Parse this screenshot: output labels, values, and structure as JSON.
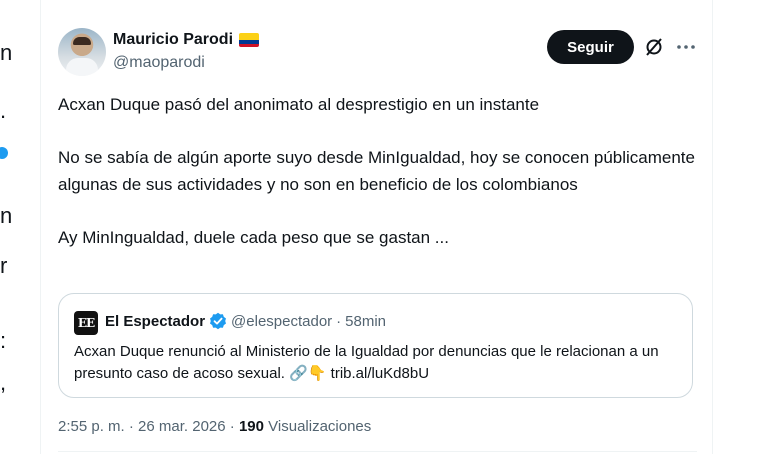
{
  "author": {
    "display_name": "Mauricio Parodi",
    "handle": "@maoparodi",
    "flag": "colombia-flag-icon"
  },
  "actions": {
    "follow_label": "Seguir"
  },
  "tweet": {
    "text": "Acxan Duque pasó del anonimato al desprestigio en un instante\n\nNo se sabía de algún aporte suyo desde MinIgualdad, hoy se conocen públicamente algunas de sus actividades y no son en beneficio de los colombianos\n\nAy MinIngualdad, duele cada peso que se gastan ..."
  },
  "quote": {
    "avatar_text": "EE",
    "name": "El Espectador",
    "handle": "@elespectador",
    "separator": "·",
    "time": "58min",
    "text": "Acxan Duque renunció al Ministerio de la Igualdad por denuncias que le relacionan a un presunto caso de acoso sexual. 🔗👇 trib.al/luKd8bU"
  },
  "meta": {
    "time": "2:55 p. m.",
    "date": "26 mar. 2026",
    "views_count": "190",
    "views_label": "Visualizaciones"
  },
  "colors": {
    "accent": "#1d9bf0",
    "text": "#0f1419",
    "muted": "#536471",
    "button_bg": "#0f1419"
  }
}
